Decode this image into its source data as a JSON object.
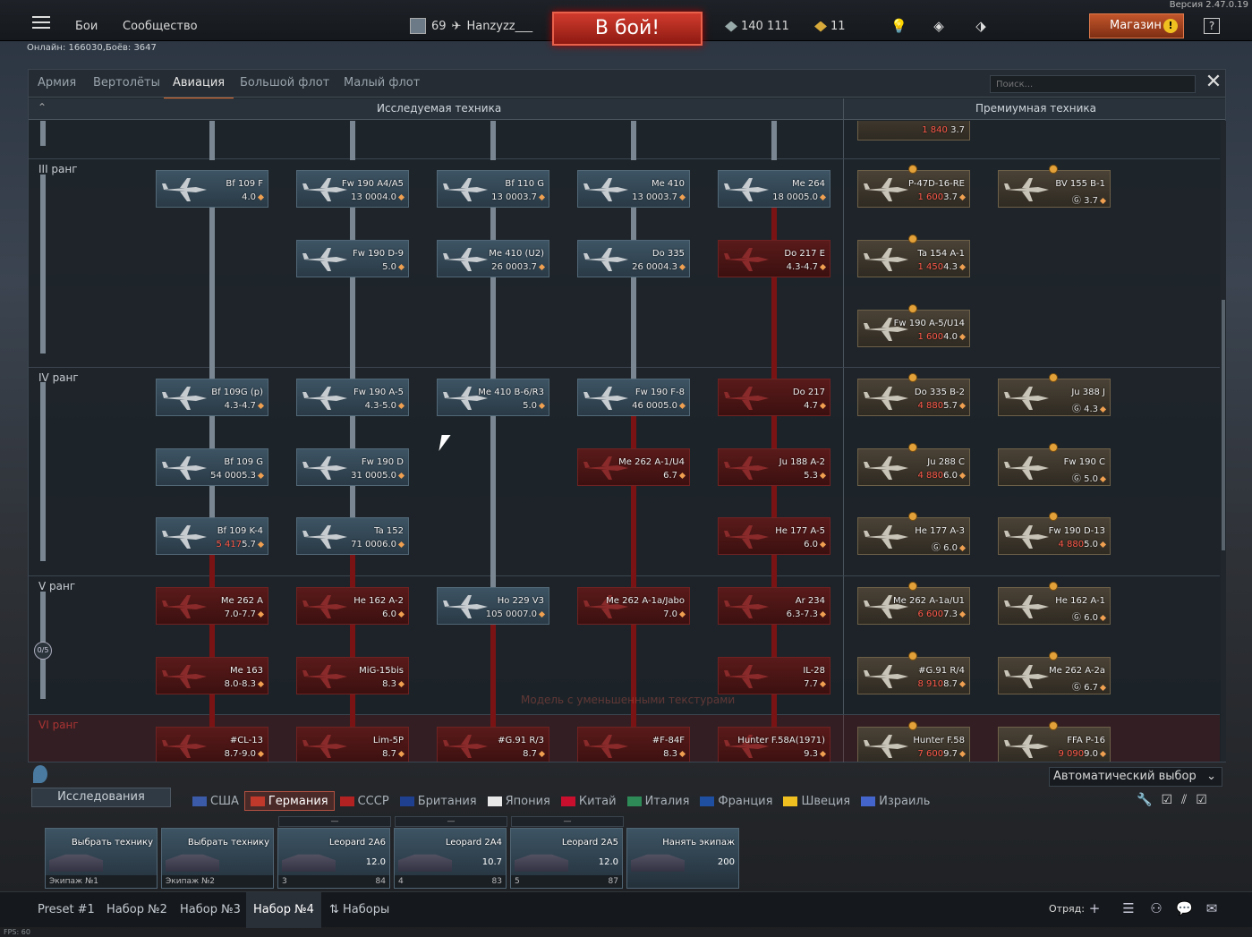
{
  "top": {
    "version": "Версия 2.47.0.19",
    "menu_battles": "Бои",
    "menu_community": "Сообщество",
    "online": "Онлайн: 166030,Боёв: 3647",
    "player_level": "69",
    "player_name": "Hanzyzz___",
    "battle_button": "В бой!",
    "silver_lions": "140 111",
    "golden_eagles": "11",
    "shop_label": "Магазин",
    "help": "?"
  },
  "vehicle_tabs": [
    "Армия",
    "Вертолёты",
    "Авиация",
    "Большой флот",
    "Малый флот"
  ],
  "active_tab": "Авиация",
  "search": {
    "placeholder": "Поиск..."
  },
  "sections": {
    "researched": "Исследуемая техника",
    "premium": "Премиумная техника"
  },
  "ranks": {
    "r3": "III ранг",
    "r4": "IV ранг",
    "r5": "V ранг",
    "r6": "VI ранг",
    "progress": "0/5"
  },
  "top_partial": {
    "cost": "1 840",
    "br": "3.7"
  },
  "tree": {
    "c1": [
      {
        "name": "Bf 109 F",
        "cost": "",
        "br": "4.0"
      },
      {
        "name": "Bf 109G (p)",
        "cost": "",
        "br": "4.3-4.7"
      },
      {
        "name": "Bf 109 G",
        "cost": "54 000",
        "br": "5.3"
      },
      {
        "name": "Bf 109 K-4",
        "cost": "5 417",
        "br": "5.7"
      },
      {
        "name": "Me 262 A",
        "cost": "",
        "br": "7.0-7.7"
      },
      {
        "name": "Me 163",
        "cost": "",
        "br": "8.0-8.3"
      },
      {
        "name": "#CL-13",
        "cost": "",
        "br": "8.7-9.0"
      }
    ],
    "c2": [
      {
        "name": "Fw 190 A4/A5",
        "cost": "13 000",
        "br": "4.0"
      },
      {
        "name": "Fw 190 D-9",
        "cost": "",
        "br": "5.0"
      },
      {
        "name": "Fw 190 A-5",
        "cost": "",
        "br": "4.3-5.0"
      },
      {
        "name": "Fw 190 D",
        "cost": "31 000",
        "br": "5.0"
      },
      {
        "name": "Ta 152",
        "cost": "71 000",
        "br": "6.0"
      },
      {
        "name": "He 162 A-2",
        "cost": "",
        "br": "6.0"
      },
      {
        "name": "MiG-15bis",
        "cost": "",
        "br": "8.3"
      },
      {
        "name": "Lim-5P",
        "cost": "",
        "br": "8.7"
      }
    ],
    "c3": [
      {
        "name": "Bf 110 G",
        "cost": "13 000",
        "br": "3.7"
      },
      {
        "name": "Me 410 (U2)",
        "cost": "26 000",
        "br": "3.7"
      },
      {
        "name": "Me 410 B-6/R3",
        "cost": "",
        "br": "5.0"
      },
      {
        "name": "Ho 229 V3",
        "cost": "105 000",
        "br": "7.0"
      },
      {
        "name": "#G.91 R/3",
        "cost": "",
        "br": "8.7"
      }
    ],
    "c4": [
      {
        "name": "Me 410",
        "cost": "13 000",
        "br": "3.7"
      },
      {
        "name": "Do 335",
        "cost": "26 000",
        "br": "4.3"
      },
      {
        "name": "Fw 190 F-8",
        "cost": "46 000",
        "br": "5.0"
      },
      {
        "name": "Me 262 A-1/U4",
        "cost": "",
        "br": "6.7"
      },
      {
        "name": "Me 262 A-1a/Jabo",
        "cost": "",
        "br": "7.0"
      },
      {
        "name": "#F-84F",
        "cost": "",
        "br": "8.3"
      }
    ],
    "c5": [
      {
        "name": "Me 264",
        "cost": "18 000",
        "br": "5.0"
      },
      {
        "name": "Do 217 E",
        "cost": "",
        "br": "4.3-4.7"
      },
      {
        "name": "Do 217",
        "cost": "",
        "br": "4.7"
      },
      {
        "name": "Ju 188 A-2",
        "cost": "",
        "br": "5.3"
      },
      {
        "name": "He 177 A-5",
        "cost": "",
        "br": "6.0"
      },
      {
        "name": "Ar 234",
        "cost": "",
        "br": "6.3-7.3"
      },
      {
        "name": "IL-28",
        "cost": "",
        "br": "7.7"
      },
      {
        "name": "Hunter F.58A(1971)",
        "cost": "",
        "br": "9.3"
      }
    ]
  },
  "premium": {
    "p1": [
      {
        "name": "P-47D-16-RE",
        "cost": "1 600",
        "br": "3.7"
      },
      {
        "name": "Ta 154 A-1",
        "cost": "1 450",
        "br": "4.3"
      },
      {
        "name": "Fw 190 A-5/U14",
        "cost": "1 600",
        "br": "4.0"
      },
      {
        "name": "Do 335 B-2",
        "cost": "4 880",
        "br": "5.7"
      },
      {
        "name": "Ju 288 C",
        "cost": "4 880",
        "br": "6.0"
      },
      {
        "name": "He 177 A-3",
        "cost": "",
        "br": "6.0"
      },
      {
        "name": "Me 262 A-1a/U1",
        "cost": "6 600",
        "br": "7.3"
      },
      {
        "name": "#G.91 R/4",
        "cost": "8 910",
        "br": "8.7"
      },
      {
        "name": "Hunter F.58",
        "cost": "7 600",
        "br": "9.7"
      }
    ],
    "p2": [
      {
        "name": "BV 155 B-1",
        "cost": "",
        "br": "3.7"
      },
      {
        "name": "Ju 388 J",
        "cost": "",
        "br": "4.3"
      },
      {
        "name": "Fw 190 C",
        "cost": "",
        "br": "5.0"
      },
      {
        "name": "Fw 190 D-13",
        "cost": "4 880",
        "br": "5.0"
      },
      {
        "name": "He 162 A-1",
        "cost": "",
        "br": "6.0"
      },
      {
        "name": "Me 262 A-2a",
        "cost": "",
        "br": "6.7"
      },
      {
        "name": "FFA P-16",
        "cost": "9 090",
        "br": "9.0"
      }
    ]
  },
  "watermark": "Модель с уменьшенными текстурами",
  "research_label": "Исследования",
  "auto_select": "Автоматический выбор",
  "nations": [
    "США",
    "Германия",
    "СССР",
    "Британия",
    "Япония",
    "Китай",
    "Италия",
    "Франция",
    "Швеция",
    "Израиль"
  ],
  "active_nation": "Германия",
  "slots": [
    {
      "title": "Выбрать технику",
      "crew": "Экипаж №1",
      "br": "",
      "num": "",
      "pts": "",
      "top": ""
    },
    {
      "title": "Выбрать технику",
      "crew": "Экипаж №2",
      "br": "",
      "num": "",
      "pts": "",
      "top": ""
    },
    {
      "title": "Leopard 2A6",
      "crew": "",
      "br": "12.0",
      "num": "3",
      "pts": "84",
      "top": "—"
    },
    {
      "title": "Leopard 2A4",
      "crew": "",
      "br": "10.7",
      "num": "4",
      "pts": "83",
      "top": "—"
    },
    {
      "title": "Leopard 2A5",
      "crew": "",
      "br": "12.0",
      "num": "5",
      "pts": "87",
      "top": "—"
    },
    {
      "title": "Нанять экипаж",
      "crew": "",
      "br": "200",
      "num": "",
      "pts": "",
      "top": ""
    }
  ],
  "presets": [
    "Preset #1",
    "Набор №2",
    "Набор №3",
    "Набор №4",
    "Наборы"
  ],
  "active_preset": "Набор №4",
  "squad_label": "Отряд:",
  "fps": "FPS: 60",
  "colors": {
    "accent": "#e06b2b",
    "locked": "#7a1414",
    "battle": "#c0392b"
  }
}
